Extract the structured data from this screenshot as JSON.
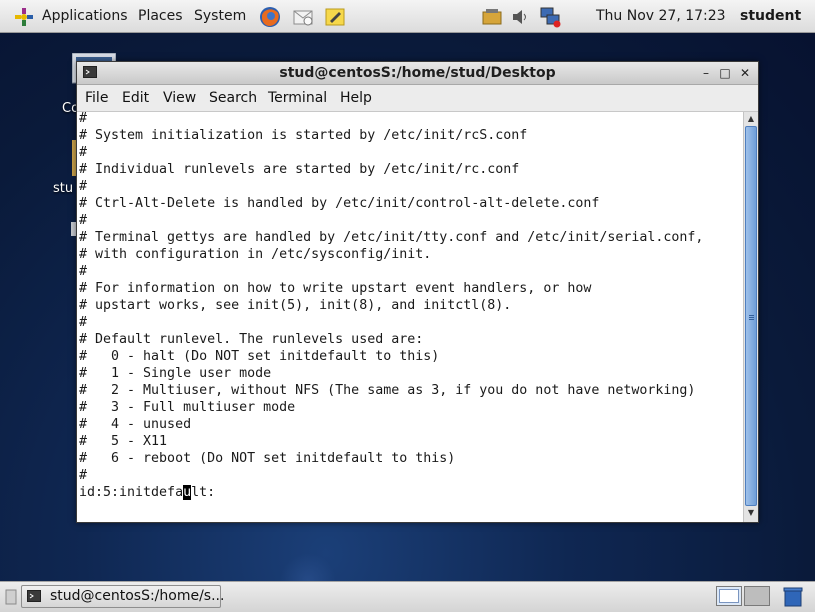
{
  "top_panel": {
    "menus": {
      "applications": "Applications",
      "places": "Places",
      "system": "System"
    },
    "launchers": [
      "firefox-icon",
      "mail-icon",
      "notes-icon"
    ],
    "tray": [
      "network-manager-icon",
      "volume-icon",
      "network-status-icon"
    ],
    "clock": "Thu Nov 27, 17:23",
    "user": "student"
  },
  "desktop": {
    "icons": [
      {
        "icon": "computer-icon",
        "label": "Co"
      },
      {
        "icon": "home-folder-icon",
        "label": "stu"
      }
    ]
  },
  "window": {
    "title": "stud@centosS:/home/stud/Desktop",
    "menu": [
      "File",
      "Edit",
      "View",
      "Search",
      "Terminal",
      "Help"
    ],
    "lines": [
      "#",
      "# System initialization is started by /etc/init/rcS.conf",
      "#",
      "# Individual runlevels are started by /etc/init/rc.conf",
      "#",
      "# Ctrl-Alt-Delete is handled by /etc/init/control-alt-delete.conf",
      "#",
      "# Terminal gettys are handled by /etc/init/tty.conf and /etc/init/serial.conf,",
      "# with configuration in /etc/sysconfig/init.",
      "#",
      "# For information on how to write upstart event handlers, or how",
      "# upstart works, see init(5), init(8), and initctl(8).",
      "#",
      "# Default runlevel. The runlevels used are:",
      "#   0 - halt (Do NOT set initdefault to this)",
      "#   1 - Single user mode",
      "#   2 - Multiuser, without NFS (The same as 3, if you do not have networking)",
      "#   3 - Full multiuser mode",
      "#   4 - unused",
      "#   5 - X11",
      "#   6 - reboot (Do NOT set initdefault to this)",
      "#"
    ],
    "editing_line": {
      "before": "id:5:initdefa",
      "cursor": "u",
      "after": "lt:"
    },
    "scroll_position": 0.97
  },
  "bottom_panel": {
    "task_label": "stud@centosS:/home/s...",
    "workspaces": [
      "workspace-1",
      "workspace-2"
    ],
    "trash": "trash-icon"
  },
  "colors": {
    "cursor": "#000000",
    "thumb": "#7aa6dc",
    "desktop": "#0f2752"
  }
}
